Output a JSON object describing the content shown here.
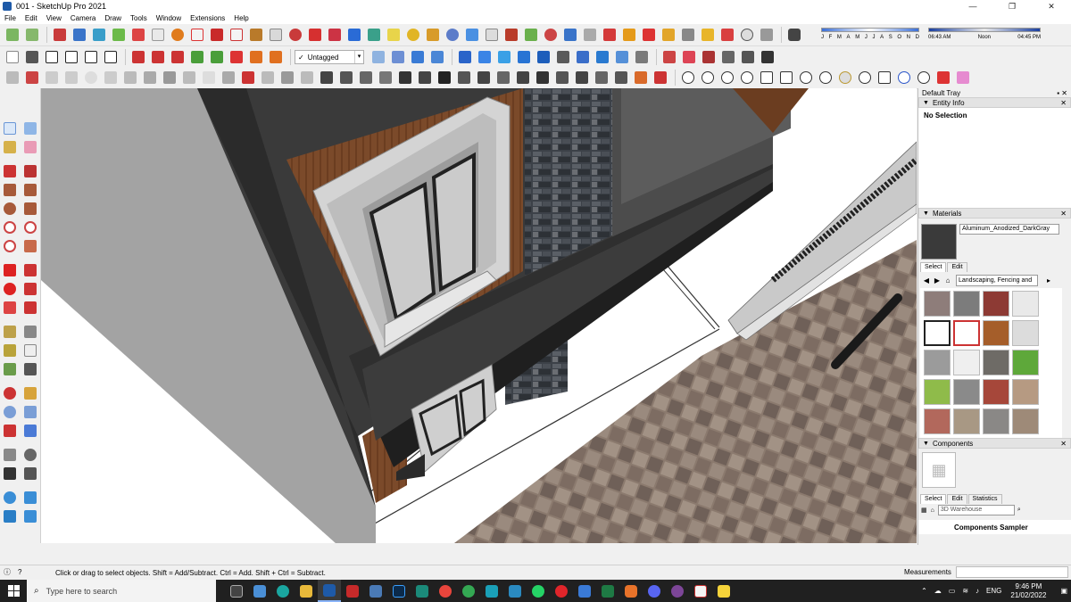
{
  "window": {
    "title": "001 - SketchUp Pro 2021",
    "minimize": "—",
    "restore": "❐",
    "close": "✕"
  },
  "menu": [
    "File",
    "Edit",
    "View",
    "Camera",
    "Draw",
    "Tools",
    "Window",
    "Extensions",
    "Help"
  ],
  "toolbar": {
    "tag_value": "Untagged",
    "tag_check": "✓",
    "months": [
      "J",
      "F",
      "M",
      "A",
      "M",
      "J",
      "J",
      "A",
      "S",
      "O",
      "N",
      "D"
    ],
    "time_start": "06:43 AM",
    "time_noon": "Noon",
    "time_end": "04:45 PM"
  },
  "tray": {
    "title": "Default Tray",
    "close": "▪ ✕",
    "entity_info": {
      "title": "Entity Info",
      "selection": "No Selection"
    },
    "materials": {
      "title": "Materials",
      "current": "Aluminum_Anodized_DarkGray",
      "tab_select": "Select",
      "tab_edit": "Edit",
      "library": "Landscaping, Fencing and"
    },
    "components": {
      "title": "Components",
      "tab_select": "Select",
      "tab_edit": "Edit",
      "tab_statistics": "Statistics",
      "search_placeholder": "3D Warehouse",
      "sampler": "Components Sampler"
    }
  },
  "status": {
    "hint": "Click or drag to select objects. Shift = Add/Subtract. Ctrl = Add. Shift + Ctrl = Subtract.",
    "measurements_label": "Measurements"
  },
  "taskbar": {
    "search_placeholder": "Type here to search",
    "language": "ENG",
    "time": "9:46 PM",
    "date": "21/02/2022"
  },
  "colors": {
    "accent": "#1e5aa8",
    "viewport_bg": "#ffffff",
    "taskbar_bg": "#202020",
    "material_swatch": "#3a3a3a"
  }
}
